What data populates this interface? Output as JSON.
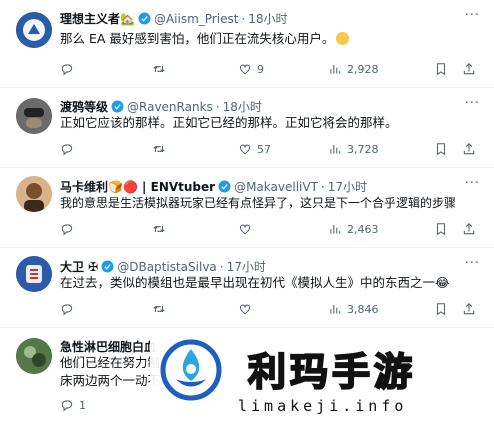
{
  "tweets": [
    {
      "name": "理想主义者🏡",
      "handle": "@Aiism_Priest",
      "time": "18小时",
      "text": "那么 EA 最好感到害怕，他们正在流失核心用户。",
      "emoji": "sweat-smile",
      "replies": "",
      "retweets": "",
      "likes": "9",
      "views": "2,928"
    },
    {
      "name": "渡鸦等级",
      "handle": "@RavenRanks",
      "time": "18小时",
      "text": "正如它应该的那样。正如它已经的那样。正如它将会的那样。",
      "replies": "",
      "retweets": "",
      "likes": "57",
      "views": "3,728"
    },
    {
      "name": "马卡维利🍞🔴 | ENVtuber",
      "handle": "@MakavelliVT",
      "time": "17小时",
      "text": "我的意思是生活模拟器玩家已经有点怪异了，这只是下一个合乎逻辑的步骤",
      "replies": "",
      "retweets": "",
      "likes": "",
      "views": "2,463"
    },
    {
      "name": "大卫 ✠",
      "handle": "@DBaptistaSilva",
      "time": "17小时",
      "text": "在过去，类似的模组也是最早出现在初代《模拟人生》中的东西之一😂",
      "replies": "",
      "retweets": "",
      "likes": "",
      "views": "3,846"
    },
    {
      "name": "急性淋巴细胞白血",
      "handle": "",
      "time": "",
      "text": "他们已经在努力制",
      "text2": "床两边两个一动不",
      "replies": "1",
      "retweets": "",
      "likes": "",
      "views": ""
    }
  ],
  "watermark": {
    "title": "利玛手游",
    "subtitle": "limakeji.info"
  },
  "more_label": "···"
}
